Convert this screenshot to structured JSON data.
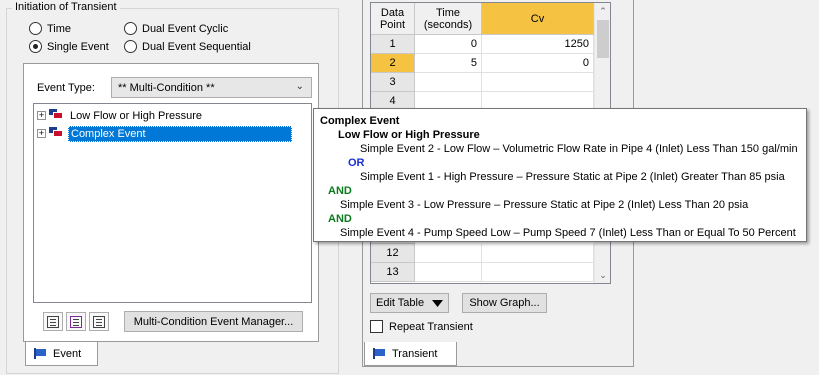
{
  "initiation": {
    "title": "Initiation of Transient",
    "radios": [
      {
        "label": "Time",
        "checked": false
      },
      {
        "label": "Dual Event Cyclic",
        "checked": false
      },
      {
        "label": "Single Event",
        "checked": true
      },
      {
        "label": "Dual Event Sequential",
        "checked": false
      }
    ]
  },
  "event_panel": {
    "event_type_label": "Event Type:",
    "event_type_value": "** Multi-Condition **",
    "tree": [
      {
        "label": "Low Flow or High Pressure",
        "selected": false
      },
      {
        "label": "Complex Event",
        "selected": true
      }
    ],
    "manager_button": "Multi-Condition Event Manager...",
    "tab_label": "Event"
  },
  "transient_panel": {
    "columns": [
      "Data Point",
      "Time (seconds)",
      "Cv"
    ],
    "rows": [
      {
        "point": "1",
        "time": "0",
        "cv": "1250"
      },
      {
        "point": "2",
        "time": "5",
        "cv": "0"
      },
      {
        "point": "3",
        "time": "",
        "cv": ""
      },
      {
        "point": "4",
        "time": "",
        "cv": ""
      },
      {
        "point": "12",
        "time": "",
        "cv": ""
      },
      {
        "point": "13",
        "time": "",
        "cv": ""
      }
    ],
    "edit_table_button": "Edit Table",
    "show_graph_button": "Show Graph...",
    "repeat_label": "Repeat Transient",
    "tab_label": "Transient"
  },
  "tooltip": {
    "title": "Complex Event",
    "group": "Low Flow or High Pressure",
    "line1": "Simple Event 2 - Low Flow – Volumetric Flow Rate in Pipe 4 (Inlet) Less Than 150 gal/min",
    "or": "OR",
    "line2": "Simple Event 1 - High Pressure – Pressure Static at Pipe 2 (Inlet) Greater Than 85 psia",
    "and1": "AND",
    "line3": "Simple Event 3 - Low Pressure – Pressure Static at Pipe 2 (Inlet) Less Than 20 psia",
    "and2": "AND",
    "line4": "Simple Event 4 - Pump Speed Low – Pump Speed 7 (Inlet) Less Than or Equal To 50 Percent"
  },
  "colors": {
    "selection": "#0078d7",
    "active_row": "#f5c242",
    "or_keyword": "#1a2ed6",
    "and_keyword": "#0c7a1e"
  }
}
